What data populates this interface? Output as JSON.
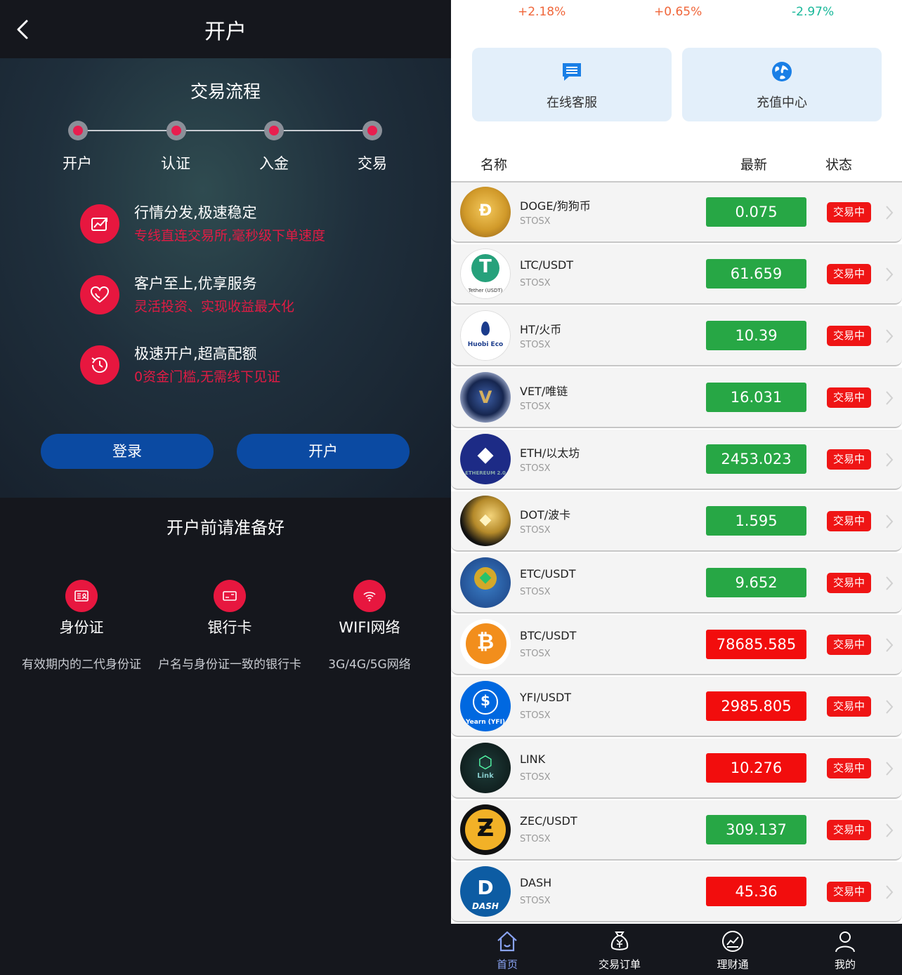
{
  "header": {
    "title": "开户"
  },
  "hero": {
    "title": "交易流程",
    "steps": [
      "开户",
      "认证",
      "入金",
      "交易"
    ],
    "features": [
      {
        "title": "行情分发,极速稳定",
        "subtitle": "专线直连交易所,毫秒级下单速度",
        "icon": "chart-trend-icon"
      },
      {
        "title": "客户至上,优享服务",
        "subtitle": "灵活投资、实现收益最大化",
        "icon": "heart-icon"
      },
      {
        "title": "极速开户,超高配额",
        "subtitle": "0资金门槛,无需线下见证",
        "icon": "clock-history-icon"
      }
    ],
    "login_label": "登录",
    "register_label": "开户"
  },
  "prepare": {
    "title": "开户前请准备好",
    "items": [
      {
        "name": "身份证",
        "desc": "有效期内的二代身份证",
        "icon": "id-card-icon"
      },
      {
        "name": "银行卡",
        "desc": "户名与身份证一致的银行卡",
        "icon": "bank-card-icon"
      },
      {
        "name": "WIFI网络",
        "desc": "3G/4G/5G网络",
        "icon": "wifi-icon"
      }
    ]
  },
  "market_top": {
    "changes": [
      "+2.18%",
      "+0.65%",
      "-2.97%"
    ],
    "colors": {
      "up": "#f0663a",
      "down": "#19b89a"
    }
  },
  "quick_actions": [
    {
      "label": "在线客服",
      "icon": "chat-icon"
    },
    {
      "label": "充值中心",
      "icon": "globe-icon"
    }
  ],
  "table": {
    "headers": {
      "name": "名称",
      "latest": "最新",
      "status": "状态"
    },
    "rows": [
      {
        "name": "DOGE/狗狗币",
        "exchange": "STOSX",
        "price": "0.075",
        "trend": "up",
        "status": "交易中",
        "coin": "doge"
      },
      {
        "name": "LTC/USDT",
        "exchange": "STOSX",
        "price": "61.659",
        "trend": "up",
        "status": "交易中",
        "coin": "usdt"
      },
      {
        "name": "HT/火币",
        "exchange": "STOSX",
        "price": "10.39",
        "trend": "up",
        "status": "交易中",
        "coin": "huobi"
      },
      {
        "name": "VET/唯链",
        "exchange": "STOSX",
        "price": "16.031",
        "trend": "up",
        "status": "交易中",
        "coin": "vet"
      },
      {
        "name": "ETH/以太坊",
        "exchange": "STOSX",
        "price": "2453.023",
        "trend": "up",
        "status": "交易中",
        "coin": "eth"
      },
      {
        "name": "DOT/波卡",
        "exchange": "STOSX",
        "price": "1.595",
        "trend": "up",
        "status": "交易中",
        "coin": "dot"
      },
      {
        "name": "ETC/USDT",
        "exchange": "STOSX",
        "price": "9.652",
        "trend": "up",
        "status": "交易中",
        "coin": "etc"
      },
      {
        "name": "BTC/USDT",
        "exchange": "STOSX",
        "price": "78685.585",
        "trend": "down",
        "status": "交易中",
        "coin": "btc"
      },
      {
        "name": "YFI/USDT",
        "exchange": "STOSX",
        "price": "2985.805",
        "trend": "down",
        "status": "交易中",
        "coin": "yfi"
      },
      {
        "name": "LINK",
        "exchange": "STOSX",
        "price": "10.276",
        "trend": "down",
        "status": "交易中",
        "coin": "link"
      },
      {
        "name": "ZEC/USDT",
        "exchange": "STOSX",
        "price": "309.137",
        "trend": "up",
        "status": "交易中",
        "coin": "zec"
      },
      {
        "name": "DASH",
        "exchange": "STOSX",
        "price": "45.36",
        "trend": "down",
        "status": "交易中",
        "coin": "dash"
      }
    ],
    "colors": {
      "up": "#27a745",
      "down": "#f20d0d",
      "status": "#ef1515"
    }
  },
  "coin_badges": {
    "usdt_caption": "Tether (USDT)",
    "huobi_caption": "Huobi Eco",
    "eth_caption": "ETHEREUM 2.0",
    "yfi_caption": "Yearn (YFI)",
    "link_caption": "Link",
    "dash_caption": "DASH"
  },
  "tabbar": {
    "tabs": [
      {
        "label": "首页",
        "icon": "home-icon",
        "active": true
      },
      {
        "label": "交易订单",
        "icon": "money-bag-icon",
        "active": false
      },
      {
        "label": "理财通",
        "icon": "chart-circle-icon",
        "active": false
      },
      {
        "label": "我的",
        "icon": "user-icon",
        "active": false
      }
    ],
    "active_color": "#8aa4f5"
  }
}
